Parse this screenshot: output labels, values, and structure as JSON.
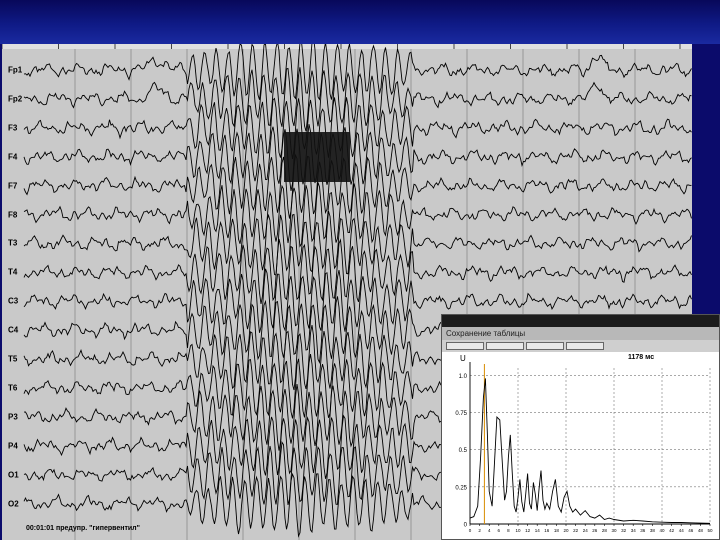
{
  "eeg": {
    "channels": [
      "Fp1",
      "Fp2",
      "F3",
      "F4",
      "F7",
      "F8",
      "T3",
      "T4",
      "C3",
      "C4",
      "T5",
      "T6",
      "P3",
      "P4",
      "O1",
      "O2"
    ],
    "time_label": "00:01:01 предупр. \"гипервентил\""
  },
  "fft_window": {
    "title": "Сохранение таблицы",
    "buttons": [
      "",
      "",
      "",
      ""
    ],
    "u_label": "U",
    "ms_label": "1178 мс"
  },
  "chart_data": {
    "type": "line",
    "title": "",
    "xlabel": "",
    "ylabel": "U",
    "annotation": "1178 мс",
    "xlim": [
      0,
      50
    ],
    "ylim": [
      0,
      1.05
    ],
    "y_ticks": [
      "0",
      "0.25",
      "0.5",
      "0.75",
      "1.0"
    ],
    "x_ticks": [
      "0",
      "2",
      "4",
      "6",
      "8",
      "10",
      "12",
      "14",
      "16",
      "18",
      "20",
      "22",
      "24",
      "26",
      "28",
      "30",
      "32",
      "34",
      "36",
      "38",
      "40",
      "42",
      "44",
      "46",
      "48",
      "50"
    ],
    "marker_x": 3,
    "series": [
      {
        "name": "",
        "x": [
          0,
          0.8,
          1.6,
          2.2,
          2.8,
          3.2,
          3.6,
          4.0,
          4.6,
          5.0,
          5.6,
          6.2,
          6.8,
          7.2,
          7.6,
          8.0,
          8.4,
          8.8,
          9.2,
          9.6,
          10.0,
          10.4,
          10.8,
          11.2,
          11.6,
          12.0,
          12.4,
          12.8,
          13.2,
          13.6,
          14.0,
          14.4,
          14.8,
          15.2,
          15.6,
          16.0,
          16.6,
          17.2,
          17.8,
          18.4,
          19.0,
          19.6,
          20.2,
          20.8,
          21.4,
          22,
          23,
          24,
          25,
          26,
          27,
          28,
          29,
          30,
          32,
          34,
          36,
          38,
          40,
          42,
          44,
          46,
          48,
          50
        ],
        "y": [
          0.04,
          0.05,
          0.12,
          0.45,
          0.85,
          0.98,
          0.62,
          0.22,
          0.12,
          0.35,
          0.72,
          0.7,
          0.38,
          0.16,
          0.22,
          0.45,
          0.6,
          0.35,
          0.12,
          0.08,
          0.18,
          0.3,
          0.15,
          0.08,
          0.2,
          0.34,
          0.14,
          0.1,
          0.28,
          0.2,
          0.09,
          0.24,
          0.36,
          0.16,
          0.1,
          0.14,
          0.1,
          0.22,
          0.3,
          0.12,
          0.08,
          0.18,
          0.22,
          0.12,
          0.08,
          0.1,
          0.06,
          0.09,
          0.05,
          0.04,
          0.06,
          0.03,
          0.04,
          0.03,
          0.02,
          0.025,
          0.02,
          0.015,
          0.012,
          0.01,
          0.01,
          0.008,
          0.006,
          0.005
        ]
      }
    ]
  }
}
